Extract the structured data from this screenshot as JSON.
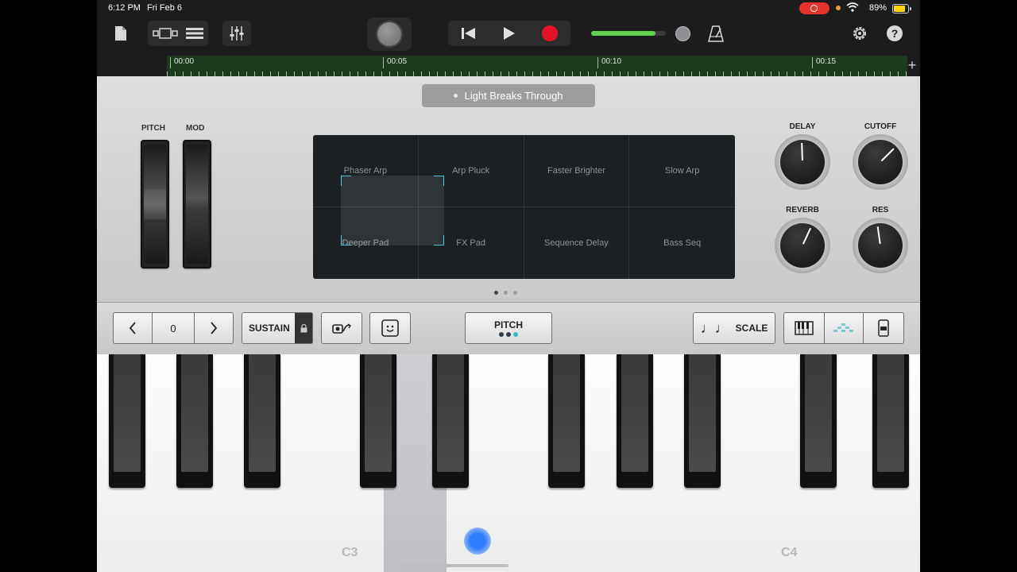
{
  "status_bar": {
    "time": "6:12 PM",
    "date": "Fri Feb 6",
    "battery": "89%",
    "battery_level": 0.89
  },
  "toolbar": {
    "doc_icon": "document-icon",
    "view_icons": [
      "tracks-view-icon",
      "list-view-icon"
    ],
    "mixer_icon": "mixer-sliders-icon",
    "transport_icons": [
      "rewind-icon",
      "play-icon",
      "record-icon"
    ],
    "metronome_icon": "metronome-icon",
    "settings_icon": "gear-icon",
    "help_label": "?"
  },
  "ruler": {
    "marks": [
      "00:00",
      "00:05",
      "00:10",
      "00:15"
    ],
    "add_label": "+"
  },
  "synth": {
    "patch_name": "Light Breaks Through",
    "wheels": {
      "pitch_label": "PITCH",
      "mod_label": "MOD"
    },
    "pads": [
      "Phaser Arp",
      "Arp Pluck",
      "Faster Brighter",
      "Slow Arp",
      "Deeper Pad",
      "FX Pad",
      "Sequence Delay",
      "Bass Seq"
    ],
    "knobs": {
      "delay_label": "DELAY",
      "cutoff_label": "CUTOFF",
      "reverb_label": "REVERB",
      "res_label": "RES"
    }
  },
  "controls": {
    "octave_value": "0",
    "prev_label": "‹",
    "next_label": "›",
    "sustain_label": "SUSTAIN",
    "pitch_label": "PITCH",
    "scale_label": "SCALE",
    "note_glyph": "♩♩"
  },
  "keyboard": {
    "labels": [
      "C3",
      "C4"
    ]
  }
}
